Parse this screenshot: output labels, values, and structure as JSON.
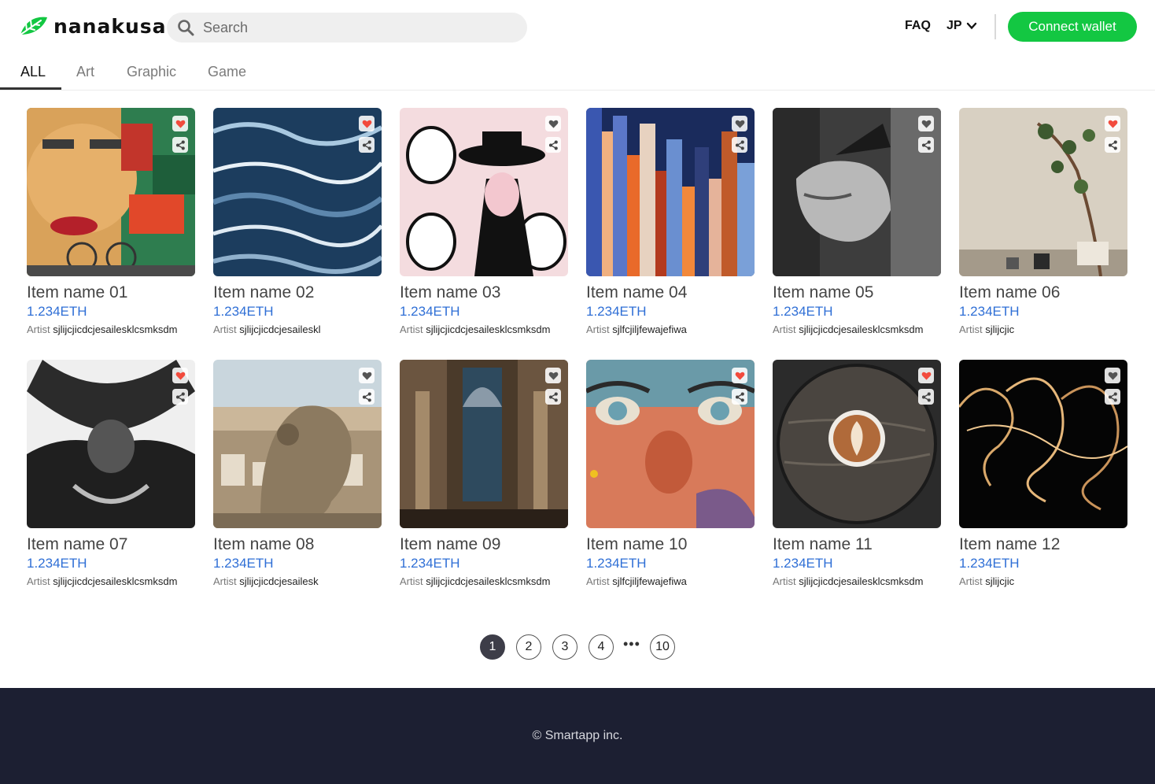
{
  "brand": {
    "name": "nanakusa"
  },
  "search": {
    "placeholder": "Search"
  },
  "nav": {
    "faq": "FAQ",
    "language": "JP",
    "connect_label": "Connect wallet"
  },
  "tabs": [
    {
      "label": "ALL",
      "active": true
    },
    {
      "label": "Art",
      "active": false
    },
    {
      "label": "Graphic",
      "active": false
    },
    {
      "label": "Game",
      "active": false
    }
  ],
  "items": [
    {
      "name": "Item name 01",
      "price": "1.234ETH",
      "artist_prefix": "Artist",
      "artist": "sjlijcjicdcjesailesklcsmksdm",
      "liked": true
    },
    {
      "name": "Item name 02",
      "price": "1.234ETH",
      "artist_prefix": "Artist",
      "artist": "sjlijcjicdcjesaileskl",
      "liked": true
    },
    {
      "name": "Item name 03",
      "price": "1.234ETH",
      "artist_prefix": "Artist",
      "artist": "sjlijcjicdcjesailesklcsmksdm",
      "liked": false
    },
    {
      "name": "Item name 04",
      "price": "1.234ETH",
      "artist_prefix": "Artist",
      "artist": "sjlfcjiljfewajefiwa",
      "liked": false
    },
    {
      "name": "Item name 05",
      "price": "1.234ETH",
      "artist_prefix": "Artist",
      "artist": "sjlijcjicdcjesailesklcsmksdm",
      "liked": false
    },
    {
      "name": "Item name 06",
      "price": "1.234ETH",
      "artist_prefix": "Artist",
      "artist": "sjlijcjic",
      "liked": true
    },
    {
      "name": "Item name 07",
      "price": "1.234ETH",
      "artist_prefix": "Artist",
      "artist": "sjlijcjicdcjesailesklcsmksdm",
      "liked": true
    },
    {
      "name": "Item name 08",
      "price": "1.234ETH",
      "artist_prefix": "Artist",
      "artist": "sjlijcjicdcjesailesk",
      "liked": false
    },
    {
      "name": "Item name 09",
      "price": "1.234ETH",
      "artist_prefix": "Artist",
      "artist": "sjlijcjicdcjesailesklcsmksdm",
      "liked": false
    },
    {
      "name": "Item name 10",
      "price": "1.234ETH",
      "artist_prefix": "Artist",
      "artist": "sjlfcjiljfewajefiwa",
      "liked": true
    },
    {
      "name": "Item name 11",
      "price": "1.234ETH",
      "artist_prefix": "Artist",
      "artist": "sjlijcjicdcjesailesklcsmksdm",
      "liked": true
    },
    {
      "name": "Item name 12",
      "price": "1.234ETH",
      "artist_prefix": "Artist",
      "artist": "sjlijcjic",
      "liked": false
    }
  ],
  "pagination": {
    "pages": [
      "1",
      "2",
      "3",
      "4"
    ],
    "ellipsis": "•••",
    "last": "10",
    "current": "1"
  },
  "footer": {
    "copyright": "© Smartapp inc."
  },
  "colors": {
    "accent": "#13c742",
    "price": "#2f6fd6",
    "liked": "#f24b3d",
    "footer_bg": "#1c1f32"
  }
}
